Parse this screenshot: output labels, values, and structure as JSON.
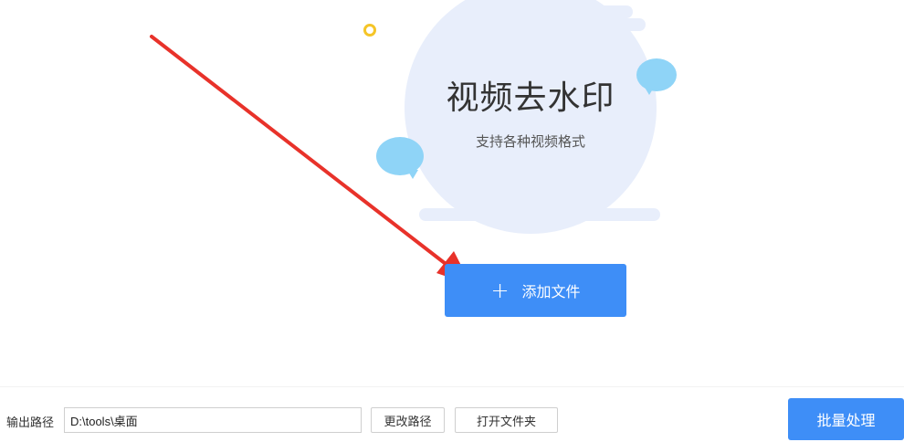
{
  "hero": {
    "title": "视频去水印",
    "subtitle": "支持各种视频格式"
  },
  "add_file": {
    "icon": "plus-icon",
    "icon_glyph": "+",
    "label": "添加文件"
  },
  "footer": {
    "output_label": "输出路径",
    "output_path": "D:\\tools\\桌面",
    "change_path_label": "更改路径",
    "open_folder_label": "打开文件夹",
    "batch_label": "批量处理"
  },
  "colors": {
    "accent": "#3e8ef7",
    "hero_bg": "#e8eefb",
    "bubble": "#8fd4f7",
    "annotation_arrow": "#e8322a"
  }
}
